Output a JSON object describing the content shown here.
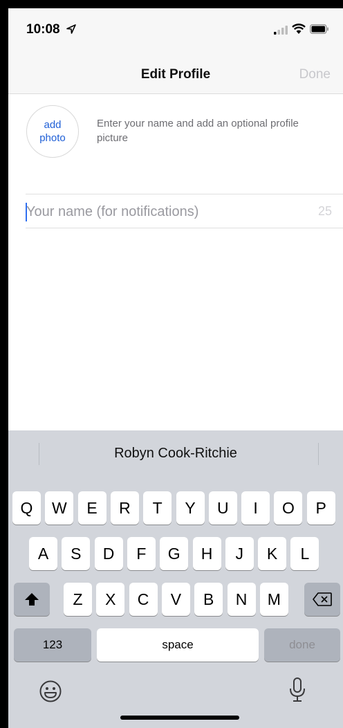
{
  "status_bar": {
    "time": "10:08"
  },
  "nav": {
    "title": "Edit Profile",
    "done_label": "Done"
  },
  "profile": {
    "add_photo_line1": "add",
    "add_photo_line2": "photo",
    "hint": "Enter your name and add an optional profile picture"
  },
  "name_field": {
    "placeholder": "Your name (for notifications)",
    "value": "",
    "char_count": "25"
  },
  "keyboard": {
    "suggestion": "Robyn Cook-Ritchie",
    "row1": [
      "Q",
      "W",
      "E",
      "R",
      "T",
      "Y",
      "U",
      "I",
      "O",
      "P"
    ],
    "row2": [
      "A",
      "S",
      "D",
      "F",
      "G",
      "H",
      "J",
      "K",
      "L"
    ],
    "row3": [
      "Z",
      "X",
      "C",
      "V",
      "B",
      "N",
      "M"
    ],
    "numbers_label": "123",
    "space_label": "space",
    "done_label": "done"
  },
  "icons": {
    "location": "location-arrow-icon",
    "signal": "cellular-signal-icon",
    "wifi": "wifi-icon",
    "battery": "battery-icon",
    "shift": "shift-icon",
    "backspace": "backspace-icon",
    "emoji": "emoji-icon",
    "mic": "microphone-icon"
  },
  "colors": {
    "accent": "#1f5fd6",
    "caret": "#2f6ff0",
    "keyboard_bg": "#d2d5db",
    "done_disabled": "#c8c8cc"
  }
}
